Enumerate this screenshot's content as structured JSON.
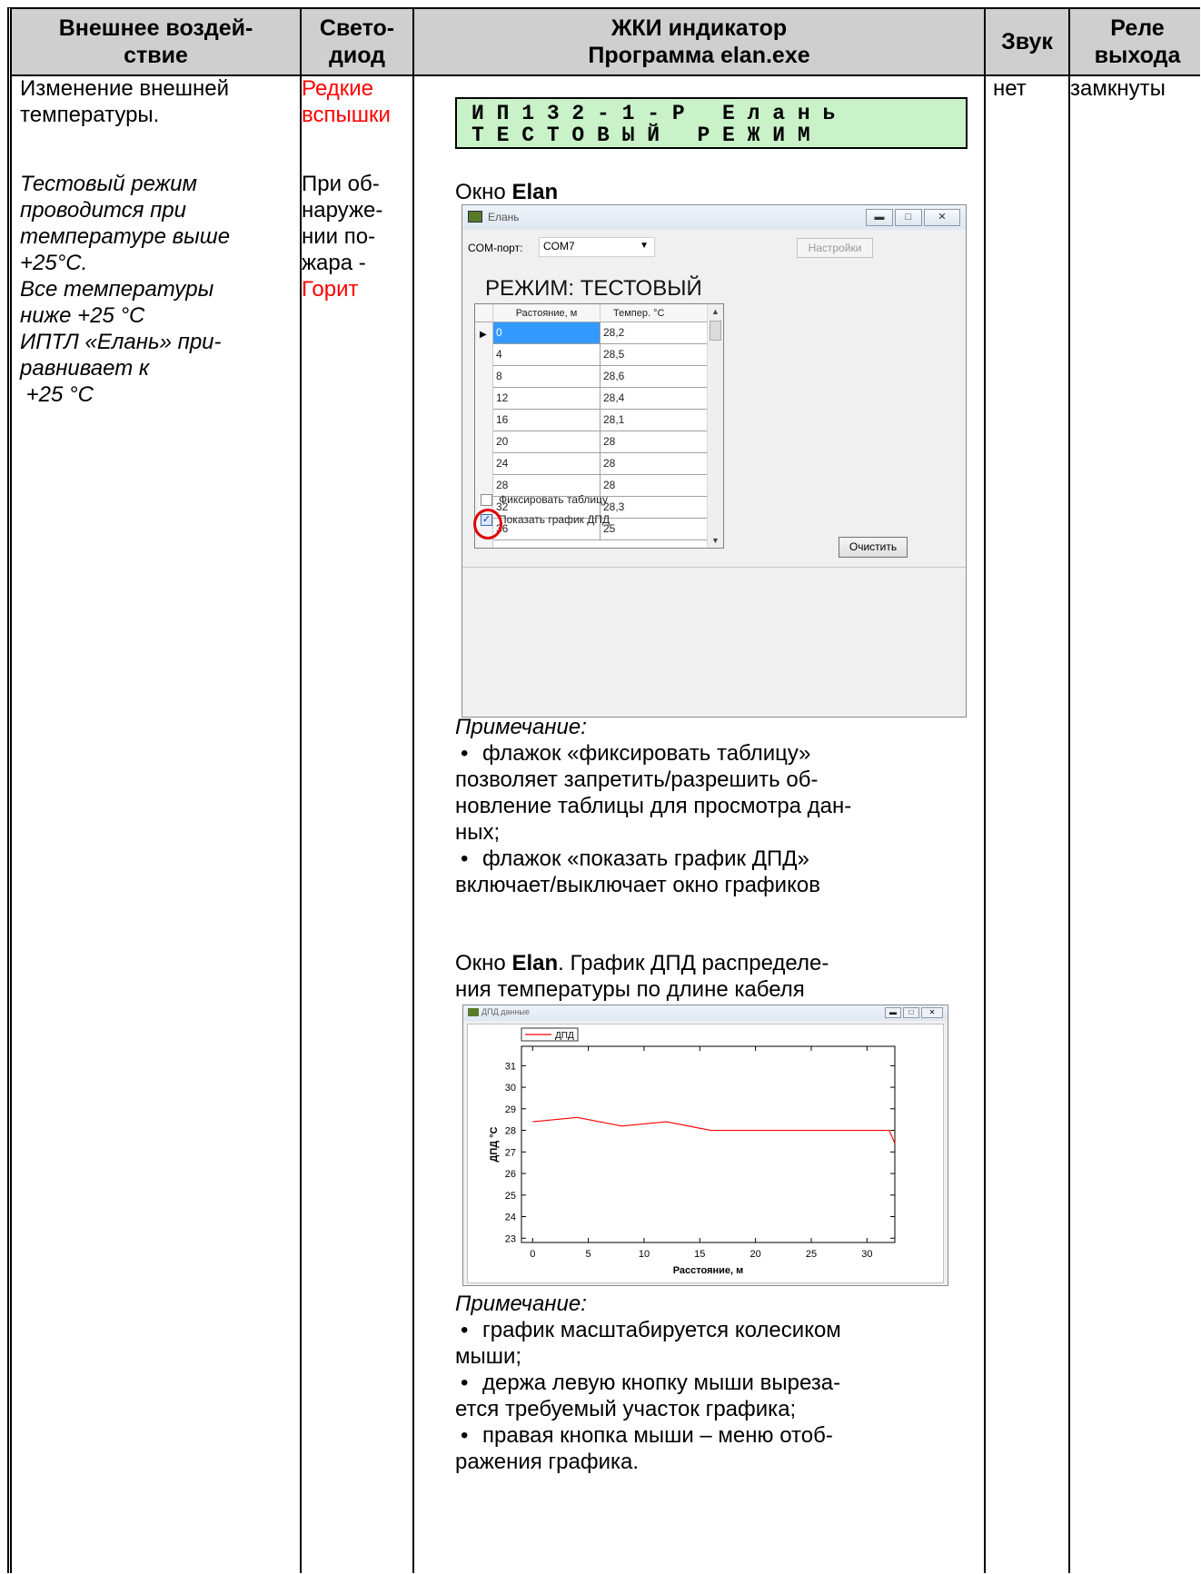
{
  "headers": {
    "col1": "Внешнее воздей-\nствие",
    "col2": "Свето-\nдиод",
    "col3": "ЖКИ индикатор\nПрограмма elan.exe",
    "col4": "Звук",
    "col5": "Реле\nвыхода"
  },
  "col1": {
    "line1": "Изменение внешней",
    "line2": "температуры.",
    "italic_lines": [
      "Тестовый режим",
      "проводится при",
      "температуре выше",
      "+25°C.",
      "Все температуры",
      "ниже +25 °C",
      "ИПТЛ «Елань» при-",
      "равнивает к",
      " +25 °C"
    ]
  },
  "col2": {
    "red1": "Редкие",
    "red2": "вспышки",
    "lines": [
      "При об-",
      "наруже-",
      "нии по-",
      "жара -"
    ],
    "red3": "Горит"
  },
  "col4": {
    "sound": "нет"
  },
  "col5": {
    "relay": "замкнуты"
  },
  "lcd": {
    "line1": "И П 1 3 2 - 1 - Р   Е л а н ь",
    "line2": "Т Е С Т О В Ы Й   Р Е Ж И М"
  },
  "window1": {
    "caption_prefix": "Окно ",
    "caption_bold": "Elan",
    "title": "Елань",
    "com_label": "COM-порт:",
    "com_value": "COM7",
    "settings_label": "Настройки",
    "mode": "РЕЖИМ: ТЕСТОВЫЙ",
    "grid_headers": [
      "Растояние, м",
      "Темпер. °C"
    ],
    "rows": [
      [
        "0",
        "28,2"
      ],
      [
        "4",
        "28,5"
      ],
      [
        "8",
        "28,6"
      ],
      [
        "12",
        "28,4"
      ],
      [
        "16",
        "28,1"
      ],
      [
        "20",
        "28"
      ],
      [
        "24",
        "28"
      ],
      [
        "28",
        "28"
      ],
      [
        "32",
        "28,3"
      ],
      [
        "36",
        "25"
      ]
    ],
    "fix_table_label": "Фиксировать таблицу",
    "fix_table_checked": false,
    "show_chart_label": "Показать график ДПД",
    "show_chart_checked": true,
    "clear_label": "Очистить"
  },
  "note1": {
    "title": "Примечание:",
    "b1": [
      "флажок «фиксировать таблицу»",
      "позволяет запретить/разрешить об-",
      "новление таблицы для просмотра дан-",
      "ных;"
    ],
    "b2": [
      "флажок «показать график ДПД»",
      "включает/выключает окно графиков"
    ]
  },
  "window2": {
    "caption_prefix": "Окно ",
    "caption_bold": "Elan",
    "caption_rest": ". График ДПД распределе-",
    "caption_line2": "ния температуры по длине кабеля",
    "title": "ДПД данные"
  },
  "chart_data": {
    "type": "line",
    "title": "",
    "xlabel": "Расстояние, м",
    "ylabel": "ДПД °C",
    "xlim": [
      -1,
      32.5
    ],
    "ylim": [
      22.8,
      31.9
    ],
    "xticks": [
      "0",
      "5",
      "10",
      "15",
      "20",
      "25",
      "30"
    ],
    "yticks": [
      "23",
      "24",
      "25",
      "26",
      "27",
      "28",
      "29",
      "30",
      "31"
    ],
    "grid": false,
    "legend": "top-left",
    "series": [
      {
        "name": "ДПД",
        "color": "#ff0000",
        "x": [
          0,
          4,
          8,
          12,
          16,
          20,
          24,
          28,
          32,
          32.5
        ],
        "y": [
          28.4,
          28.6,
          28.2,
          28.4,
          28.0,
          28.0,
          28.0,
          28.0,
          28.0,
          27.4
        ]
      }
    ]
  },
  "note2": {
    "title": "Примечание:",
    "b1": [
      "график масштабируется колесиком",
      "мыши;"
    ],
    "b2": [
      "держа левую кнопку мыши выреза-",
      "ется требуемый участок графика;"
    ],
    "b3": [
      "правая кнопка мыши – меню отоб-",
      "ражения графика."
    ]
  }
}
